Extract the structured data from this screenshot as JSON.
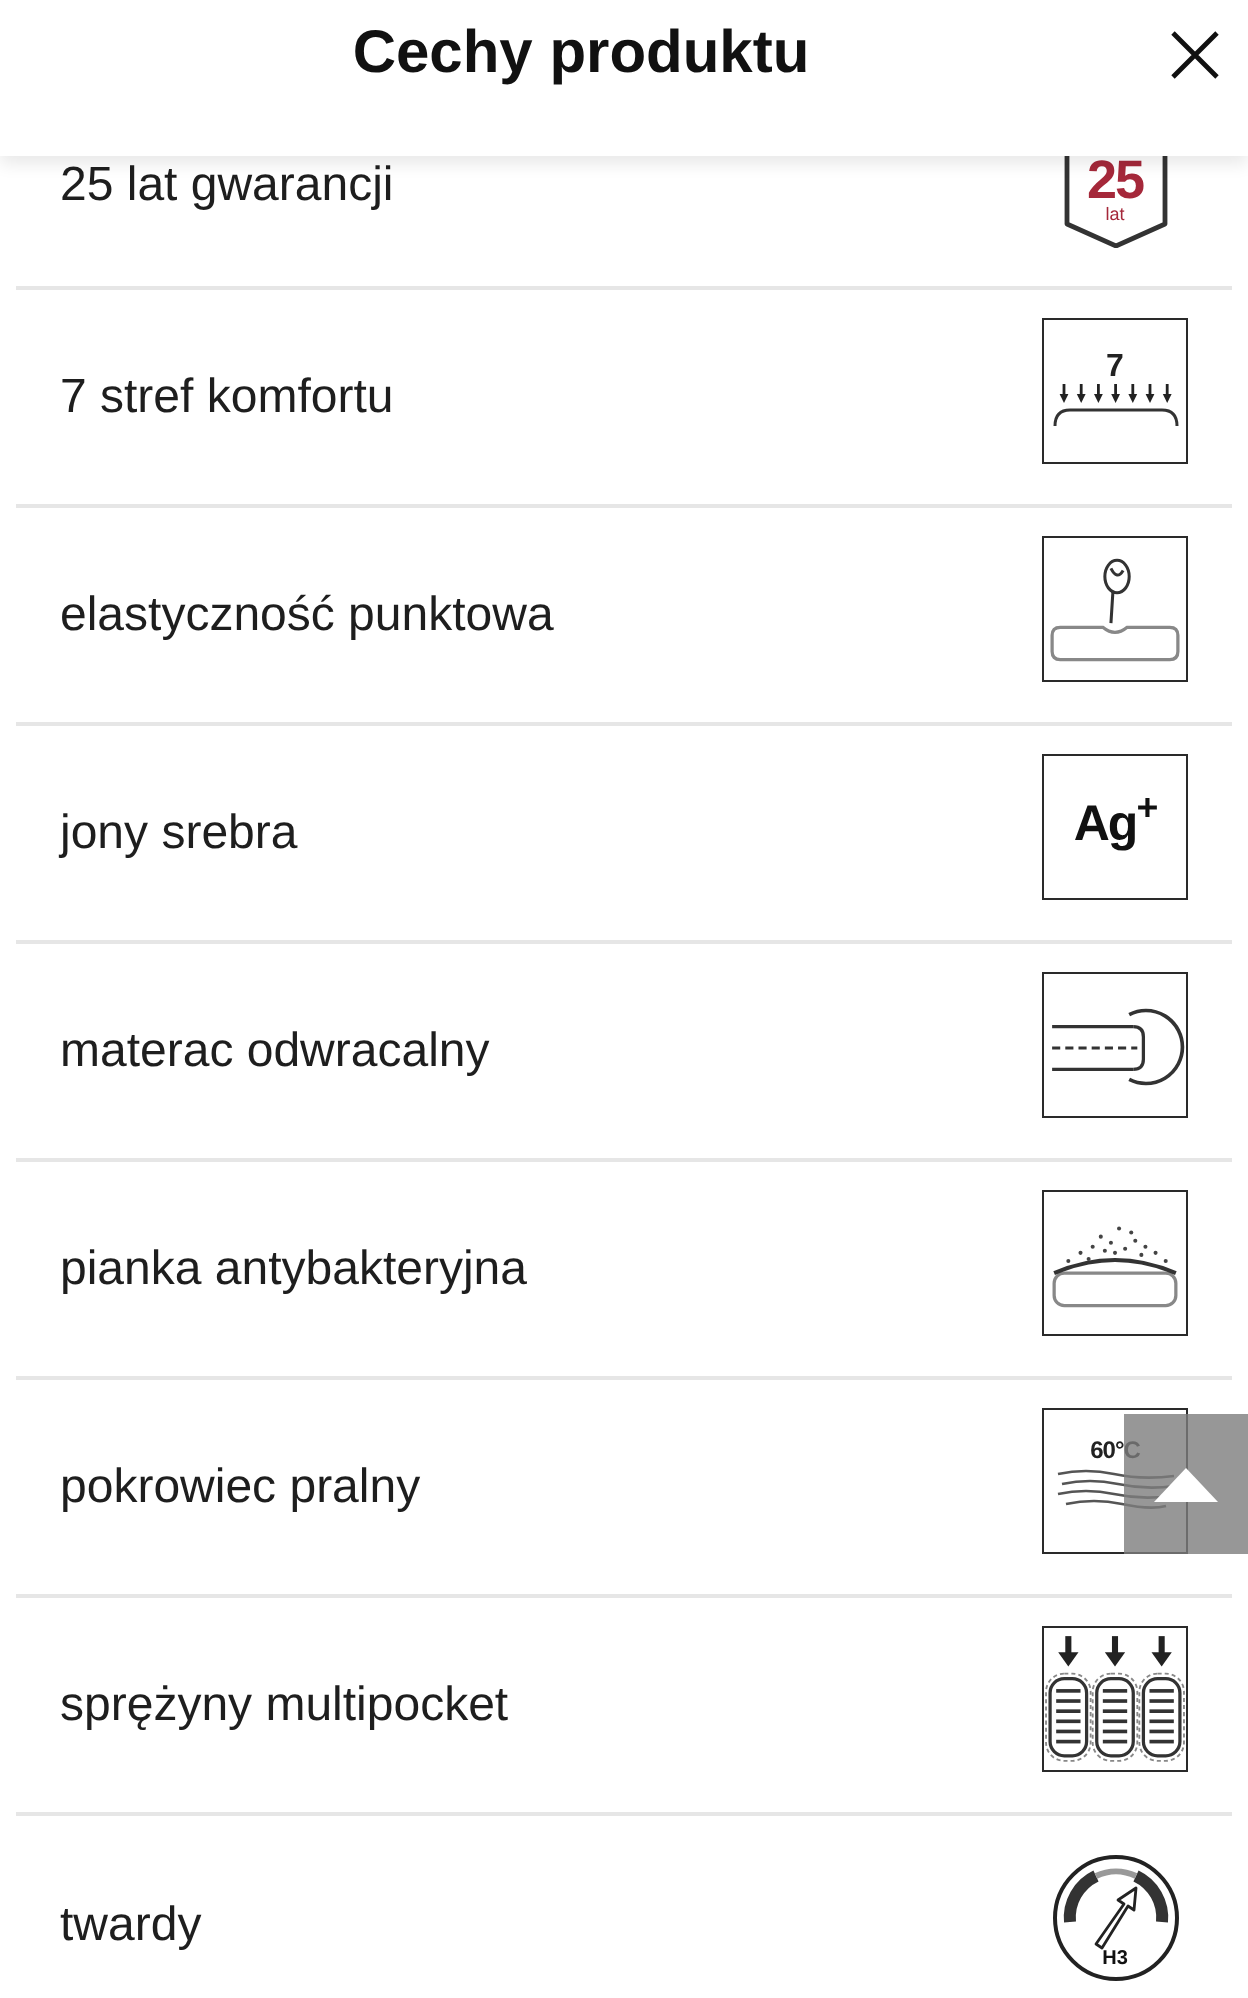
{
  "header": {
    "title": "Cechy produktu"
  },
  "features": [
    {
      "label": "25 lat gwarancji",
      "icon": {
        "kind": "warranty",
        "number": "25",
        "unit": "lat"
      }
    },
    {
      "label": "7 stref komfortu",
      "icon": {
        "kind": "zones",
        "count": "7"
      }
    },
    {
      "label": "elastyczność punktowa",
      "icon": {
        "kind": "point_elasticity"
      }
    },
    {
      "label": "jony srebra",
      "icon": {
        "kind": "silver",
        "symbol": "Ag$^{+}$"
      }
    },
    {
      "label": "materac odwracalny",
      "icon": {
        "kind": "reversible"
      }
    },
    {
      "label": "pianka antybakteryjna",
      "icon": {
        "kind": "antibacterial"
      }
    },
    {
      "label": "pokrowiec pralny",
      "icon": {
        "kind": "washable",
        "temperature": "60°C"
      }
    },
    {
      "label": "sprężyny multipocket",
      "icon": {
        "kind": "pocket_springs"
      }
    },
    {
      "label": "twardy",
      "icon": {
        "kind": "firmness",
        "grade": "H3"
      }
    }
  ]
}
